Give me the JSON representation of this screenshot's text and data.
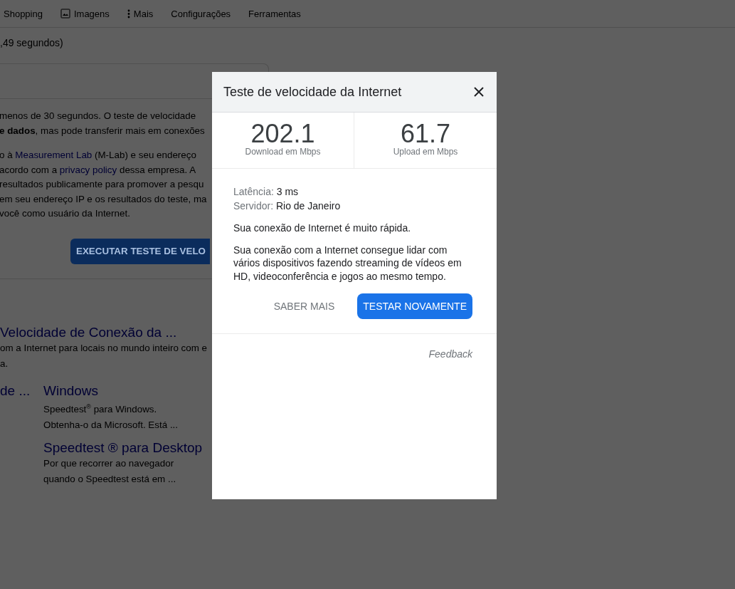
{
  "nav_tabs": [
    {
      "label": "Shopping",
      "kind": "plain"
    },
    {
      "label": "Imagens",
      "kind": "image"
    },
    {
      "label": "Mais",
      "kind": "more"
    },
    {
      "label": "Configurações",
      "kind": "plain"
    },
    {
      "label": "Ferramentas",
      "kind": "plain"
    }
  ],
  "result_stats": ",49 segundos)",
  "info_card": {
    "paragraphs": [
      [
        [
          {
            "kind": "text",
            "text": "menos de 30 segundos. O teste de velocidade"
          }
        ],
        [
          {
            "kind": "text",
            "text": "**e dados**, mas pode transferir mais em conexões"
          }
        ]
      ],
      [
        [
          {
            "kind": "text",
            "text": "o à "
          },
          {
            "kind": "link",
            "text": "Measurement Lab"
          },
          {
            "kind": "text",
            "text": " (M-Lab) e seu endereço"
          }
        ],
        [
          {
            "kind": "text",
            "text": "acordo com a "
          },
          {
            "kind": "link",
            "text": "privacy policy"
          },
          {
            "kind": "text",
            "text": " dessa empresa. A"
          }
        ],
        [
          {
            "kind": "text",
            "text": "resultados publicamente para promover a pesqu"
          }
        ],
        [
          {
            "kind": "text",
            "text": "em seu endereço IP e os resultados do teste, ma"
          }
        ],
        [
          {
            "kind": "text",
            "text": "você como usuário da Internet."
          }
        ]
      ]
    ],
    "button": "EXECUTAR TESTE DE VELO"
  },
  "results": [
    {
      "title": "Velocidade de Conexão da ...",
      "snippet": [
        "om a Internet para locais no mundo inteiro com e",
        "a."
      ]
    }
  ],
  "sitelinks": [
    {
      "title": "de ..."
    },
    {
      "title": "Windows",
      "snippet": [
        "Speedtest$^{®}$ para Windows.",
        "Obtenha-o da Microsoft. Está ..."
      ]
    },
    {
      "title": "Speedtest ® para Desktop",
      "snippet": [
        "Por que recorrer ao navegador",
        "quando o Speedtest está em ..."
      ]
    }
  ],
  "dialog": {
    "title": "Teste de velocidade da Internet",
    "stats": [
      {
        "value": "202.1",
        "label": "Download em Mbps"
      },
      {
        "value": "61.7",
        "label": "Upload em Mbps"
      }
    ],
    "details": [
      {
        "label": "Latência:",
        "value": "3 ms"
      },
      {
        "label": "Servidor:",
        "value": "Rio de Janeiro"
      }
    ],
    "verdict": "Sua conexão de Internet é muito rápida.",
    "description": "Sua conexão com a Internet consegue lidar com vários dispositivos fazendo streaming de vídeos em HD, videoconferência e jogos ao mesmo tempo.",
    "buttons": [
      {
        "label": "SABER MAIS",
        "kind": "text"
      },
      {
        "label": "TESTAR NOVAMENTE",
        "kind": "primary"
      }
    ],
    "feedback": "Feedback"
  }
}
